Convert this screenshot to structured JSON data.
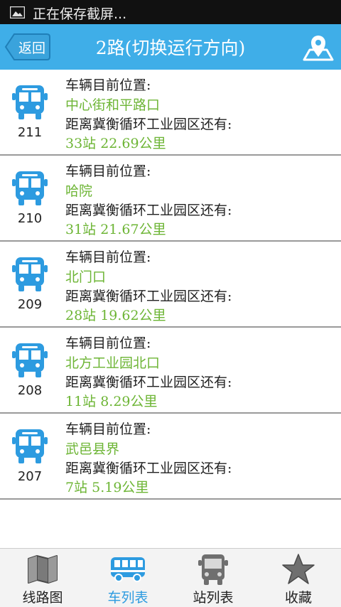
{
  "status_bar": {
    "text": "正在保存截屏..."
  },
  "header": {
    "back_label": "返回",
    "title": "2路(切换运行方向)"
  },
  "colors": {
    "header": "#3faee8",
    "bus_icon": "#2d9be0",
    "highlight": "#6db535",
    "active_tab": "#2d9be0"
  },
  "buses": [
    {
      "number": "211",
      "position_label": "车辆目前位置:",
      "location": "中心街和平路口",
      "distance_label": "距离冀衡循环工业园区还有:",
      "distance": "33站  22.69公里"
    },
    {
      "number": "210",
      "position_label": "车辆目前位置:",
      "location": "哈院",
      "distance_label": "距离冀衡循环工业园区还有:",
      "distance": "31站  21.67公里"
    },
    {
      "number": "209",
      "position_label": "车辆目前位置:",
      "location": "北门口",
      "distance_label": "距离冀衡循环工业园区还有:",
      "distance": "28站  19.62公里"
    },
    {
      "number": "208",
      "position_label": "车辆目前位置:",
      "location": "北方工业园北口",
      "distance_label": "距离冀衡循环工业园区还有:",
      "distance": "11站  8.29公里"
    },
    {
      "number": "207",
      "position_label": "车辆目前位置:",
      "location": "武邑县界",
      "distance_label": "距离冀衡循环工业园区还有:",
      "distance": "7站  5.19公里"
    }
  ],
  "nav": {
    "items": [
      {
        "label": "线路图",
        "icon": "map-icon"
      },
      {
        "label": "车列表",
        "icon": "bus-side-icon",
        "active": true
      },
      {
        "label": "站列表",
        "icon": "bus-front-icon"
      },
      {
        "label": "收藏",
        "icon": "star-icon"
      }
    ]
  }
}
